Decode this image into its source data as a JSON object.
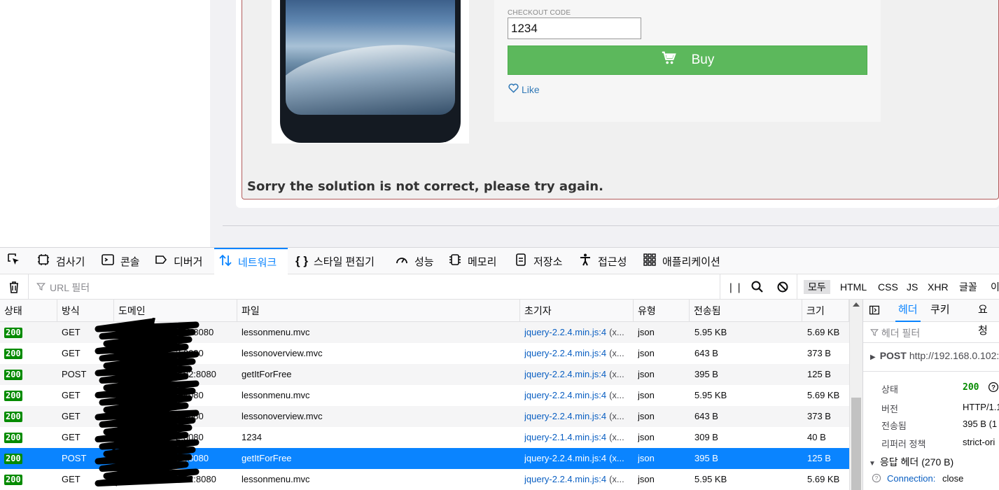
{
  "page": {
    "checkout_label": "CHECKOUT CODE",
    "checkout_value": "1234",
    "buy_label": "Buy",
    "like_label": "Like",
    "message": "Sorry the solution is not correct, please try again."
  },
  "devtools": {
    "tabs": [
      "검사기",
      "콘솔",
      "디버거",
      "네트워크",
      "스타일 편집기",
      "성능",
      "메모리",
      "저장소",
      "접근성",
      "애플리케이션"
    ],
    "active_tab": "네트워크",
    "url_filter_placeholder": "URL 필터",
    "type_filters": [
      "모두",
      "HTML",
      "CSS",
      "JS",
      "XHR",
      "글꼴",
      "이"
    ],
    "active_type_filter": "모두",
    "columns": [
      "상태",
      "방식",
      "도메인",
      "파일",
      "초기자",
      "유형",
      "전송됨",
      "크기"
    ],
    "rows": [
      {
        "status": "200",
        "method": "GET",
        "domain": "102:8080",
        "file": "lessonmenu.mvc",
        "initiator": "jquery-2.2.4.min.js:4",
        "initiator_rest": "(x...",
        "type": "json",
        "transferred": "5.95 KB",
        "size": "5.69 KB",
        "selected": false
      },
      {
        "status": "200",
        "method": "GET",
        "domain": "2:8080",
        "file": "lessonoverview.mvc",
        "initiator": "jquery-2.2.4.min.js:4",
        "initiator_rest": "(x...",
        "type": "json",
        "transferred": "643 B",
        "size": "373 B",
        "selected": false
      },
      {
        "status": "200",
        "method": "POST",
        "domain": ".102:8080",
        "file": "getItForFree",
        "initiator": "jquery-2.2.4.min.js:4",
        "initiator_rest": "(x...",
        "type": "json",
        "transferred": "395 B",
        "size": "125 B",
        "selected": false
      },
      {
        "status": "200",
        "method": "GET",
        "domain": "2:8080",
        "file": "lessonmenu.mvc",
        "initiator": "jquery-2.2.4.min.js:4",
        "initiator_rest": "(x...",
        "type": "json",
        "transferred": "5.95 KB",
        "size": "5.69 KB",
        "selected": false
      },
      {
        "status": "200",
        "method": "GET",
        "domain": "2:8080",
        "file": "lessonoverview.mvc",
        "initiator": "jquery-2.2.4.min.js:4",
        "initiator_rest": "(x...",
        "type": "json",
        "transferred": "643 B",
        "size": "373 B",
        "selected": false
      },
      {
        "status": "200",
        "method": "GET",
        "domain": "2:8080",
        "file": "1234",
        "initiator": "jquery-2.1.4.min.js:4",
        "initiator_rest": "(x...",
        "type": "json",
        "transferred": "309 B",
        "size": "40 B",
        "selected": false
      },
      {
        "status": "200",
        "method": "POST",
        "domain": "02:8080",
        "file": "getItForFree",
        "initiator": "jquery-2.2.4.min.js:4",
        "initiator_rest": "(x...",
        "type": "json",
        "transferred": "395 B",
        "size": "125 B",
        "selected": true
      },
      {
        "status": "200",
        "method": "GET",
        "domain": ".102:8080",
        "file": "lessonmenu.mvc",
        "initiator": "jquery-2.2.4.min.js:4",
        "initiator_rest": "(x...",
        "type": "json",
        "transferred": "5.95 KB",
        "size": "5.69 KB",
        "selected": false
      }
    ],
    "side": {
      "tabs": [
        "헤더",
        "쿠키",
        "요청"
      ],
      "active_tab": "헤더",
      "filter_placeholder": "헤더 필터",
      "method": "POST",
      "url": "http://192.168.0.102:",
      "status_label": "상태",
      "status_value": "200",
      "version_label": "버전",
      "version_value": "HTTP/1.1",
      "transferred_label": "전송됨",
      "transferred_value": "395 B (1",
      "referrer_label": "리퍼러 정책",
      "referrer_value": "strict-ori",
      "response_headers": "응답 헤더 (270 B)",
      "connection_key": "Connection:",
      "connection_value": "close"
    }
  }
}
